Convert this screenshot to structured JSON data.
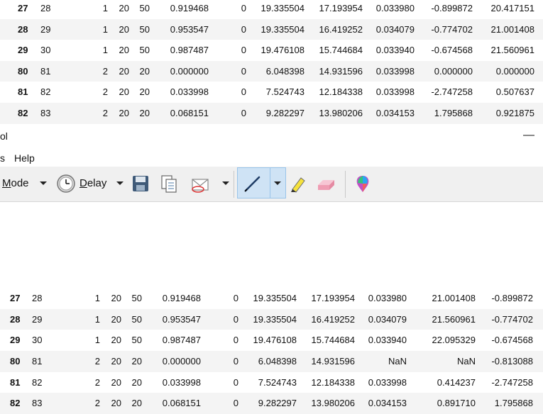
{
  "top_table": {
    "rows": [
      {
        "idx": "27",
        "c0": "28",
        "c1": "1",
        "c2": "20",
        "c3": "50",
        "c4": "0.919468",
        "c5": "0",
        "c6": "19.335504",
        "c7": "17.193954",
        "c8": "0.033980",
        "c9": "-0.899872",
        "c10": "20.417151"
      },
      {
        "idx": "28",
        "c0": "29",
        "c1": "1",
        "c2": "20",
        "c3": "50",
        "c4": "0.953547",
        "c5": "0",
        "c6": "19.335504",
        "c7": "16.419252",
        "c8": "0.034079",
        "c9": "-0.774702",
        "c10": "21.001408"
      },
      {
        "idx": "29",
        "c0": "30",
        "c1": "1",
        "c2": "20",
        "c3": "50",
        "c4": "0.987487",
        "c5": "0",
        "c6": "19.476108",
        "c7": "15.744684",
        "c8": "0.033940",
        "c9": "-0.674568",
        "c10": "21.560961"
      },
      {
        "idx": "80",
        "c0": "81",
        "c1": "2",
        "c2": "20",
        "c3": "20",
        "c4": "0.000000",
        "c5": "0",
        "c6": "6.048398",
        "c7": "14.931596",
        "c8": "0.033998",
        "c9": "0.000000",
        "c10": "0.000000"
      },
      {
        "idx": "81",
        "c0": "82",
        "c1": "2",
        "c2": "20",
        "c3": "20",
        "c4": "0.033998",
        "c5": "0",
        "c6": "7.524743",
        "c7": "12.184338",
        "c8": "0.033998",
        "c9": "-2.747258",
        "c10": "0.507637"
      },
      {
        "idx": "82",
        "c0": "83",
        "c1": "2",
        "c2": "20",
        "c3": "20",
        "c4": "0.068151",
        "c5": "0",
        "c6": "9.282297",
        "c7": "13.980206",
        "c8": "0.034153",
        "c9": "1.795868",
        "c10": "0.921875"
      }
    ]
  },
  "snip_tool": {
    "title": "ol",
    "minimize": "—",
    "menu": [
      "s",
      "Help"
    ],
    "toolbar": {
      "mode_label_pre": "",
      "mode_label_mn": "M",
      "mode_label_post": "ode",
      "delay_label_mn": "D",
      "delay_label_post": "elay",
      "icons": [
        "clock-icon",
        "save-icon",
        "copy-icon",
        "send-snip-icon",
        "pen-icon",
        "highlighter-icon",
        "eraser-icon",
        "paint3d-icon"
      ]
    }
  },
  "bottom_table": {
    "rows": [
      {
        "idx": "27",
        "c0": "28",
        "c1": "1",
        "c2": "20",
        "c3": "50",
        "c4": "0.919468",
        "c5": "0",
        "c6": "19.335504",
        "c7": "17.193954",
        "c8": "0.033980",
        "c9": "21.001408",
        "c10": "-0.899872"
      },
      {
        "idx": "28",
        "c0": "29",
        "c1": "1",
        "c2": "20",
        "c3": "50",
        "c4": "0.953547",
        "c5": "0",
        "c6": "19.335504",
        "c7": "16.419252",
        "c8": "0.034079",
        "c9": "21.560961",
        "c10": "-0.774702"
      },
      {
        "idx": "29",
        "c0": "30",
        "c1": "1",
        "c2": "20",
        "c3": "50",
        "c4": "0.987487",
        "c5": "0",
        "c6": "19.476108",
        "c7": "15.744684",
        "c8": "0.033940",
        "c9": "22.095329",
        "c10": "-0.674568"
      },
      {
        "idx": "80",
        "c0": "81",
        "c1": "2",
        "c2": "20",
        "c3": "20",
        "c4": "0.000000",
        "c5": "0",
        "c6": "6.048398",
        "c7": "14.931596",
        "c8": "NaN",
        "c9": "NaN",
        "c10": "-0.813088"
      },
      {
        "idx": "81",
        "c0": "82",
        "c1": "2",
        "c2": "20",
        "c3": "20",
        "c4": "0.033998",
        "c5": "0",
        "c6": "7.524743",
        "c7": "12.184338",
        "c8": "0.033998",
        "c9": "0.414237",
        "c10": "-2.747258"
      },
      {
        "idx": "82",
        "c0": "83",
        "c1": "2",
        "c2": "20",
        "c3": "20",
        "c4": "0.068151",
        "c5": "0",
        "c6": "9.282297",
        "c7": "13.980206",
        "c8": "0.034153",
        "c9": "0.891710",
        "c10": "1.795868"
      }
    ]
  }
}
